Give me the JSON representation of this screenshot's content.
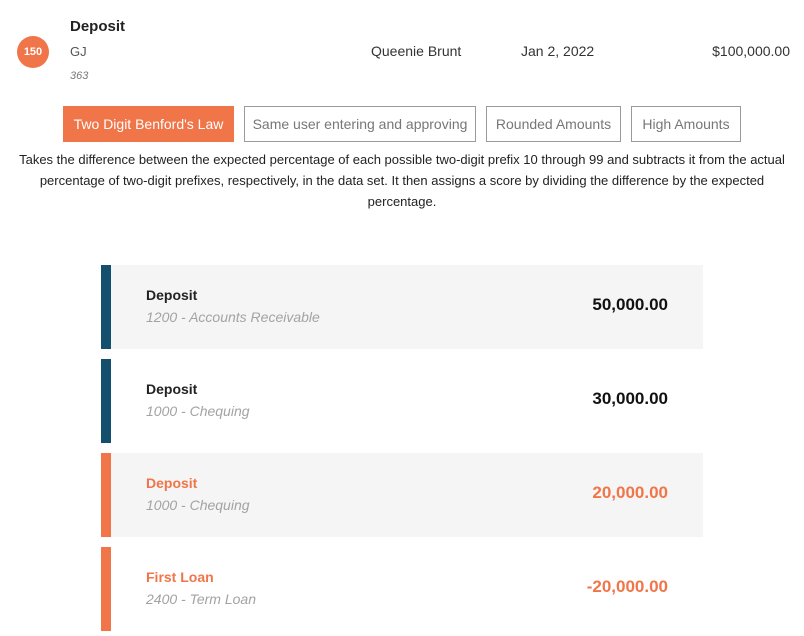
{
  "colors": {
    "accent": "#f07548",
    "normal_bar": "#14506e",
    "flagged_bar": "#f07548",
    "row_shaded": "#f5f5f5"
  },
  "transaction": {
    "score": "150",
    "title": "Deposit",
    "type": "GJ",
    "reference": "363",
    "user": "Queenie Brunt",
    "date": "Jan 2, 2022",
    "amount": "$100,000.00"
  },
  "tabs": [
    {
      "label": "Two Digit Benford's Law",
      "active": true
    },
    {
      "label": "Same user entering and approving",
      "active": false
    },
    {
      "label": "Rounded Amounts",
      "active": false
    },
    {
      "label": "High Amounts",
      "active": false
    }
  ],
  "description": "Takes the difference between the expected percentage of each possible two-digit prefix 10 through 99 and subtracts it from the actual percentage of two-digit prefixes, respectively, in the data set. It then assigns a score by dividing the difference by the expected percentage.",
  "entries": [
    {
      "name": "Deposit",
      "account": "1200 - Accounts Receivable",
      "amount": "50,000.00",
      "flagged": false,
      "shaded": true
    },
    {
      "name": "Deposit",
      "account": "1000 - Chequing",
      "amount": "30,000.00",
      "flagged": false,
      "shaded": false
    },
    {
      "name": "Deposit",
      "account": "1000 - Chequing",
      "amount": "20,000.00",
      "flagged": true,
      "shaded": true
    },
    {
      "name": "First Loan",
      "account": "2400 - Term Loan",
      "amount": "-20,000.00",
      "flagged": true,
      "shaded": false
    }
  ]
}
